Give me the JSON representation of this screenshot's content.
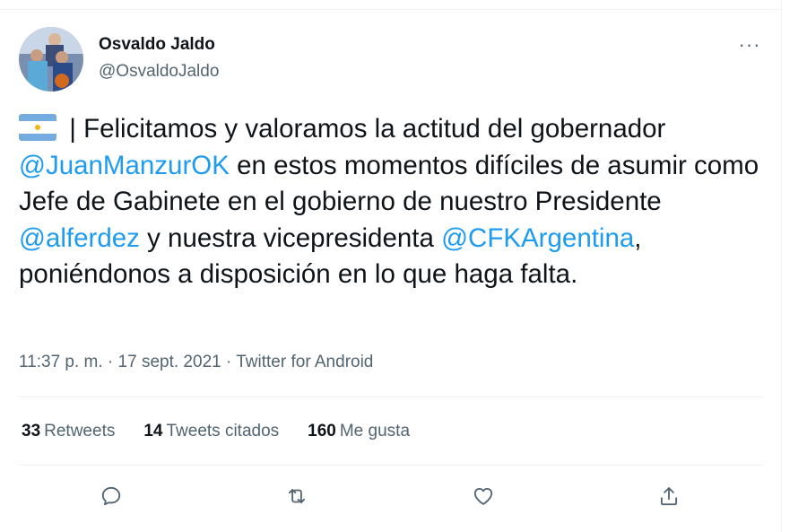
{
  "author": {
    "name": "Osvaldo Jaldo",
    "handle": "@OsvaldoJaldo"
  },
  "more_icon": "more-horizontal-icon",
  "tweet": {
    "flag_icon": "argentina-flag-icon",
    "separator": " | ",
    "text_1": "Felicitamos y valoramos la actitud del gobernador ",
    "mention_1": "@JuanManzurOK",
    "text_2": " en estos momentos difíciles de asumir como Jefe de Gabinete en el gobierno de nuestro Presidente ",
    "mention_2": "@alferdez",
    "text_3": " y nuestra vicepresidenta ",
    "mention_3": "@CFKArgentina",
    "text_4": ", poniéndonos a disposición en lo que haga falta."
  },
  "meta": {
    "time": "11:37 p. m.",
    "dot": " · ",
    "date": "17 sept. 2021",
    "source": "Twitter for Android"
  },
  "stats": {
    "retweets_count": "33",
    "retweets_label": "Retweets",
    "quotes_count": "14",
    "quotes_label": "Tweets citados",
    "likes_count": "160",
    "likes_label": "Me gusta"
  },
  "actions": {
    "reply_icon": "reply-icon",
    "retweet_icon": "retweet-icon",
    "like_icon": "like-icon",
    "share_icon": "share-icon"
  },
  "colors": {
    "accent": "#1d9bf0",
    "text": "#0f1419",
    "secondary": "#536471",
    "divider": "#eff3f4"
  }
}
